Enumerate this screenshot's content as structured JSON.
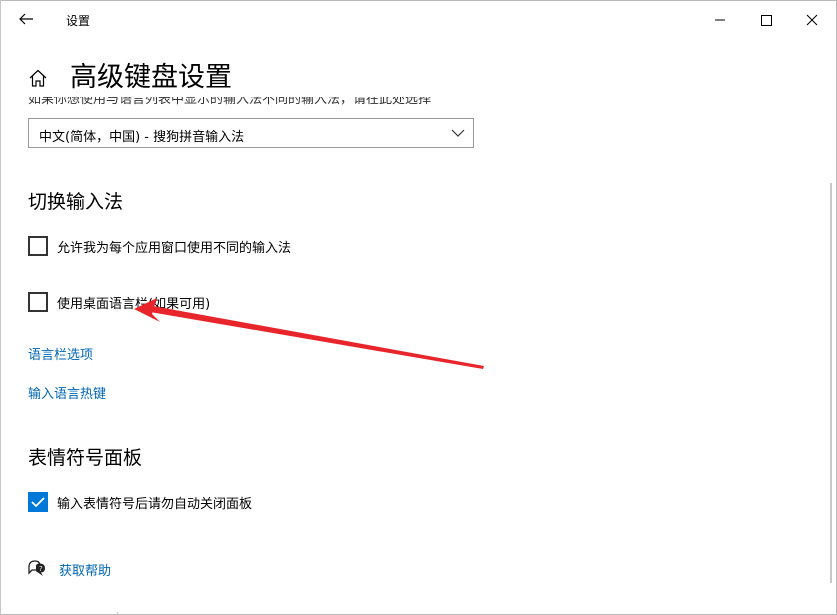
{
  "app": {
    "title": "设置"
  },
  "page": {
    "title": "高级键盘设置",
    "clipped_text": "如果你想使用与语言列表中显示的输入法不同的输入法，请在此处选择"
  },
  "default_input": {
    "selected": "中文(简体，中国) - 搜狗拼音输入法"
  },
  "switch_section": {
    "title": "切换输入法",
    "options": [
      {
        "label": "允许我为每个应用窗口使用不同的输入法",
        "checked": false
      },
      {
        "label": "使用桌面语言栏(如果可用)",
        "checked": false
      }
    ]
  },
  "links": {
    "language_bar_options": "语言栏选项",
    "input_language_hotkeys": "输入语言热键"
  },
  "emoji_section": {
    "title": "表情符号面板",
    "options": [
      {
        "label": "输入表情符号后请勿自动关闭面板",
        "checked": true
      }
    ]
  },
  "help": {
    "label": "获取帮助"
  },
  "icons": {
    "back": "back-arrow-icon",
    "minimize": "minimize-icon",
    "maximize": "maximize-icon",
    "close": "close-icon",
    "home": "home-icon",
    "chevron": "chevron-down-icon",
    "check": "checkmark-icon",
    "help": "help-chat-icon"
  },
  "colors": {
    "accent": "#0078d7",
    "link": "#0066b4",
    "annotation_arrow": "#e8252b"
  }
}
